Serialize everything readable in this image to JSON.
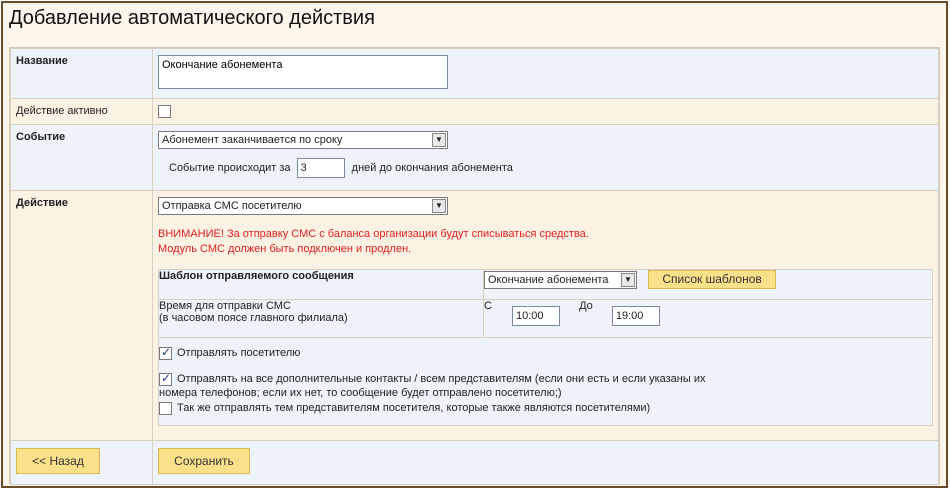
{
  "page": {
    "title": "Добавление автоматического действия"
  },
  "name": {
    "label": "Название",
    "value": "Окончание абонемента"
  },
  "active": {
    "label": "Действие активно",
    "checked": false
  },
  "event": {
    "label": "Событие",
    "selected": "Абонемент заканчивается по сроку",
    "occurs_prefix": "Событие происходит за",
    "days_value": "3",
    "occurs_suffix": "дней до окончания абонемента"
  },
  "action": {
    "label": "Действие",
    "selected": "Отправка СМС посетителю",
    "warning_line1": "ВНИМАНИЕ! За отправку СМС с баланса организации будут списываться средства.",
    "warning_line2": "Модуль СМС должен быть подключен и продлен.",
    "template_label": "Шаблон отправляемого сообщения",
    "template_selected": "Окончание абонемента",
    "template_list_button": "Список шаблонов",
    "time_label_line1": "Время для отправки СМС",
    "time_label_line2": "(в часовом поясе главного филиала)",
    "time_from_label": "С",
    "time_from_value": "10:00",
    "time_to_label": "До",
    "time_to_value": "19:00",
    "opt_send_visitor": {
      "label": "Отправлять посетителю",
      "checked": true
    },
    "opt_send_contacts": {
      "label_line1": "Отправлять на все дополнительные контакты / всем представителям (если они есть и если указаны их",
      "label_line2": "номера телефонов; если их нет, то сообщение будет отправлено посетителю;)",
      "checked": true
    },
    "opt_send_reps": {
      "label": "Так же отправлять тем представителям посетителя, которые также являются посетителями)",
      "checked": false
    }
  },
  "footer": {
    "back_button": "<< Назад",
    "save_button": "Сохранить"
  },
  "colors": {
    "accent_button": "#fbe08a",
    "warning": "#e02020",
    "frame": "#6b4a2e"
  }
}
